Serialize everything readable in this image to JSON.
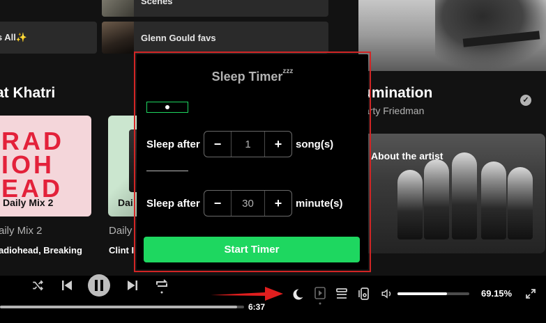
{
  "library": {
    "shortcuts": [
      {
        "label": "Scenes"
      },
      {
        "label": "ngs All✨"
      },
      {
        "label": "Glenn Gould favs"
      }
    ],
    "section_title": "at Khatri",
    "cards": [
      {
        "cover_text": "RAD\nIOH\nEAD",
        "cover_label": "Daily Mix 2",
        "title": "aily Mix 2",
        "subtitle": "adiohead, Breaking"
      },
      {
        "cover_label": "Dai",
        "title": "Daily",
        "subtitle": "Clint I"
      }
    ]
  },
  "now_playing": {
    "title": "umination",
    "artist": "arty Friedman",
    "about_label": "About the artist"
  },
  "sleep_timer": {
    "title": "Sleep Timer",
    "title_icon": "zzz",
    "song_row": {
      "label": "Sleep after",
      "value": "1",
      "unit": "song(s)",
      "minus": "−",
      "plus": "+"
    },
    "minute_row": {
      "label": "Sleep after",
      "value": "30",
      "unit": "minute(s)",
      "minus": "−",
      "plus": "+"
    },
    "start_label": "Start Timer"
  },
  "player": {
    "elapsed": "6:37",
    "progress_fraction": 0.97,
    "volume_fraction": 0.69,
    "zoom_label": "69.15%"
  },
  "colors": {
    "accent": "#1ed760",
    "annotation": "#e01e1e",
    "highlight_box": "#d12525"
  },
  "icons": [
    "shuffle-icon",
    "previous-icon",
    "pause-icon",
    "next-icon",
    "repeat-icon",
    "moon-icon",
    "now-playing-view-icon",
    "queue-icon",
    "connect-device-icon",
    "volume-icon",
    "fullscreen-icon",
    "verified-check-icon"
  ]
}
